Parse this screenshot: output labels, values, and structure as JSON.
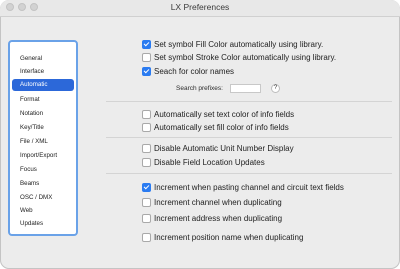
{
  "window": {
    "title": "LX Preferences"
  },
  "sidebar": {
    "items": [
      {
        "label": "General"
      },
      {
        "label": "Interface"
      },
      {
        "label": "Automatic",
        "selected": true
      },
      {
        "label": "Format"
      },
      {
        "label": "Notation"
      },
      {
        "label": "Key/Title"
      },
      {
        "label": "File / XML"
      },
      {
        "label": "Import/Export"
      },
      {
        "label": "Focus"
      },
      {
        "label": "Beams"
      },
      {
        "label": "OSC / DMX"
      },
      {
        "label": "Web"
      },
      {
        "label": "Updates"
      }
    ]
  },
  "options": {
    "fill_color_library": {
      "label": "Set symbol Fill Color automatically using library.",
      "checked": true
    },
    "stroke_color_library": {
      "label": "Set symbol Stroke Color automatically using library.",
      "checked": false
    },
    "search_color_names": {
      "label": "Seach for color names",
      "checked": true
    },
    "search_prefixes": {
      "label": "Search prefixes:",
      "value": "",
      "help": "?"
    },
    "auto_text_color": {
      "label": "Automatically set text color of info fields",
      "checked": false
    },
    "auto_fill_color": {
      "label": "Automatically set fill color of info fields",
      "checked": false
    },
    "disable_unit_number": {
      "label": "Disable Automatic Unit Number Display",
      "checked": false
    },
    "disable_field_location": {
      "label": "Disable Field Location Updates",
      "checked": false
    },
    "increment_pasting": {
      "label": "Increment when pasting channel and circuit text fields",
      "checked": true
    },
    "increment_channel": {
      "label": "Increment channel when duplicating",
      "checked": false
    },
    "increment_address": {
      "label": "Increment address when duplicating",
      "checked": false
    },
    "increment_position": {
      "label": "Increment position name when duplicating",
      "checked": false
    }
  }
}
